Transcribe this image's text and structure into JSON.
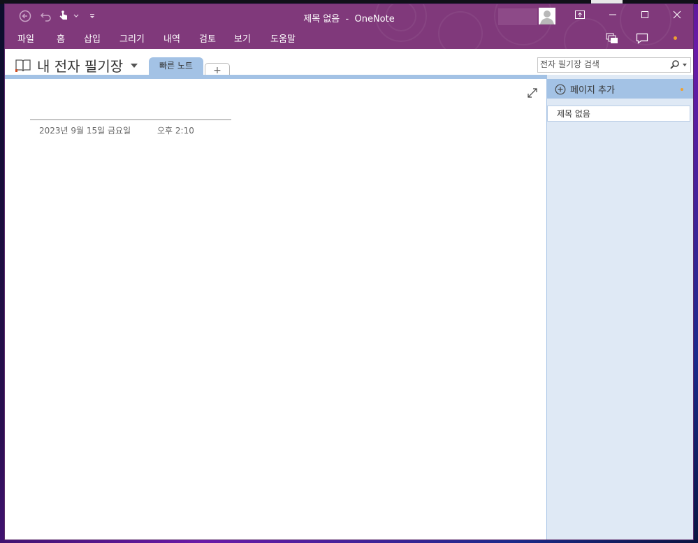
{
  "window": {
    "title_doc": "제목 없음",
    "title_sep": "-",
    "title_app": "OneNote"
  },
  "menu": [
    "파일",
    "홈",
    "삽입",
    "그리기",
    "내역",
    "검토",
    "보기",
    "도움말"
  ],
  "notebook": {
    "name": "내 전자 필기장",
    "active_section": "빠른 노트",
    "add_section": "+"
  },
  "search": {
    "placeholder": "전자 필기장 검색"
  },
  "page": {
    "date": "2023년 9월 15일 금요일",
    "time": "오후 2:10"
  },
  "pagelist": {
    "add_page": "페이지 추가",
    "pages": [
      "제목 없음"
    ]
  },
  "colors": {
    "title_bar": "#80397b",
    "section_tab": "#a3c2e5",
    "page_panel": "#dfe9f5",
    "accent_dot": "#f0a030"
  },
  "icons": [
    "back-icon",
    "undo-icon",
    "touch-mode-icon",
    "customize-qat-icon",
    "notebook-icon",
    "search-icon",
    "expand-icon",
    "add-page-icon",
    "minimize-icon",
    "maximize-icon",
    "close-icon",
    "ribbon-display-icon",
    "multi-window-icon",
    "comment-icon"
  ]
}
